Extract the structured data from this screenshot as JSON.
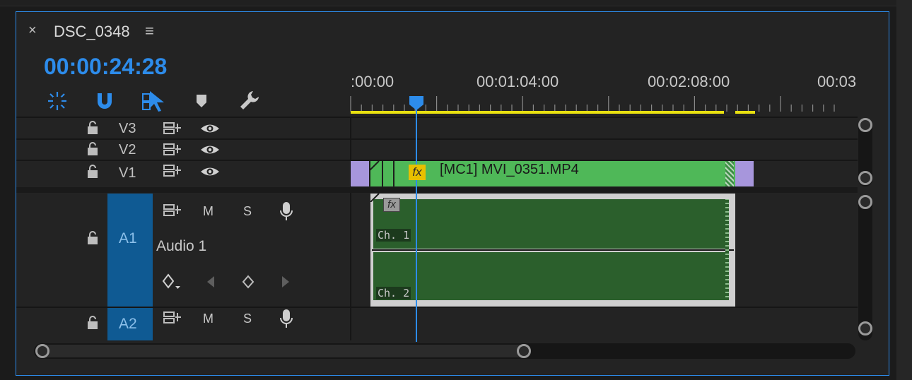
{
  "tab": {
    "close": "×",
    "title": "DSC_0348",
    "menu": "≡"
  },
  "timecode": "00:00:24:28",
  "toolbar": {
    "icons": [
      "snap-nest-icon",
      "magnet-icon",
      "linked-selection-icon",
      "marker-icon",
      "wrench-icon"
    ]
  },
  "ruler": {
    "labels": [
      ":00:00",
      "00:01:04:00",
      "00:02:08:00",
      "00:03"
    ]
  },
  "tracks": {
    "v3": {
      "name": "V3"
    },
    "v2": {
      "name": "V2"
    },
    "v1": {
      "name": "V1"
    },
    "a1": {
      "name": "A1",
      "label": "Audio 1",
      "mute": "M",
      "solo": "S"
    },
    "a2": {
      "name": "A2",
      "mute": "M",
      "solo": "S"
    }
  },
  "clips": {
    "video": {
      "fx": "fx",
      "title": "[MC1] MVI_0351.MP4"
    },
    "audio": {
      "fx": "fx",
      "ch1": "Ch. 1",
      "ch2": "Ch. 2"
    }
  },
  "colors": {
    "accent": "#2d8ceb",
    "video_clip": "#4fb858",
    "audio_clip": "#2b5f2c",
    "transition": "#a796dc",
    "work_area": "#e8e010",
    "track_target": "#0f5a93"
  }
}
